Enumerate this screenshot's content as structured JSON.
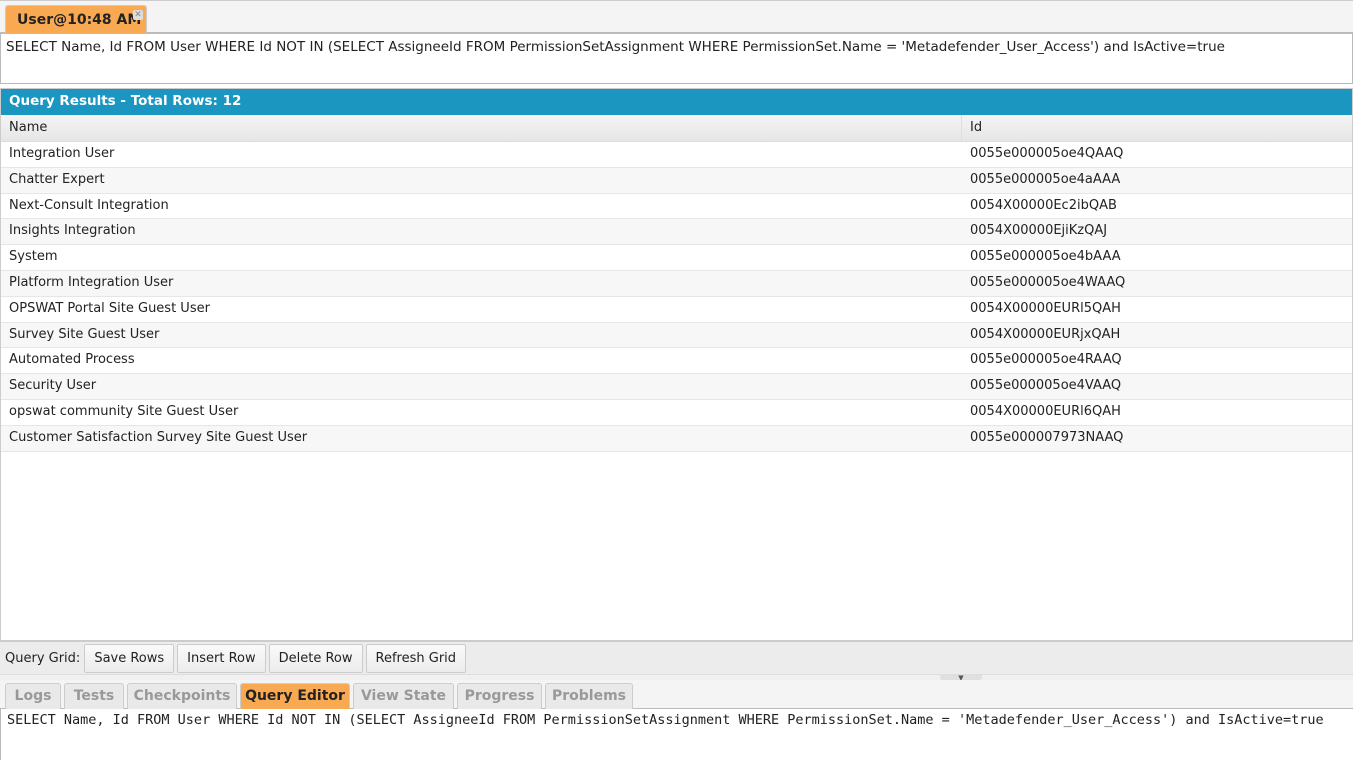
{
  "file_tab": {
    "label": "User@10:48 AM",
    "close_icon": "close-icon"
  },
  "query_text": "SELECT Name, Id FROM User WHERE Id NOT IN (SELECT AssigneeId FROM PermissionSetAssignment WHERE PermissionSet.Name = 'Metadefender_User_Access') and IsActive=true",
  "results": {
    "title": "Query Results - Total Rows: 12",
    "columns": [
      "Name",
      "Id"
    ],
    "rows": [
      [
        "Integration User",
        "0055e000005oe4QAAQ"
      ],
      [
        "Chatter Expert",
        "0055e000005oe4aAAA"
      ],
      [
        "Next-Consult Integration",
        "0054X00000Ec2ibQAB"
      ],
      [
        "Insights Integration",
        "0054X00000EjiKzQAJ"
      ],
      [
        "System",
        "0055e000005oe4bAAA"
      ],
      [
        "Platform Integration User",
        "0055e000005oe4WAAQ"
      ],
      [
        "OPSWAT Portal Site Guest User",
        "0054X00000EURl5QAH"
      ],
      [
        "Survey Site Guest User",
        "0054X00000EURjxQAH"
      ],
      [
        "Automated Process",
        "0055e000005oe4RAAQ"
      ],
      [
        "Security User",
        "0055e000005oe4VAAQ"
      ],
      [
        "opswat community Site Guest User",
        "0054X00000EURl6QAH"
      ],
      [
        "Customer Satisfaction Survey Site Guest User",
        "0055e000007973NAAQ"
      ]
    ]
  },
  "toolbar": {
    "label": "Query Grid:",
    "save": "Save Rows",
    "insert": "Insert Row",
    "delete": "Delete Row",
    "refresh": "Refresh Grid"
  },
  "bottom_tabs": [
    "Logs",
    "Tests",
    "Checkpoints",
    "Query Editor",
    "View State",
    "Progress",
    "Problems"
  ],
  "active_bottom_tab": "Query Editor",
  "colors": {
    "header_blue": "#1a96c0",
    "active_tab": "#f9a952"
  }
}
